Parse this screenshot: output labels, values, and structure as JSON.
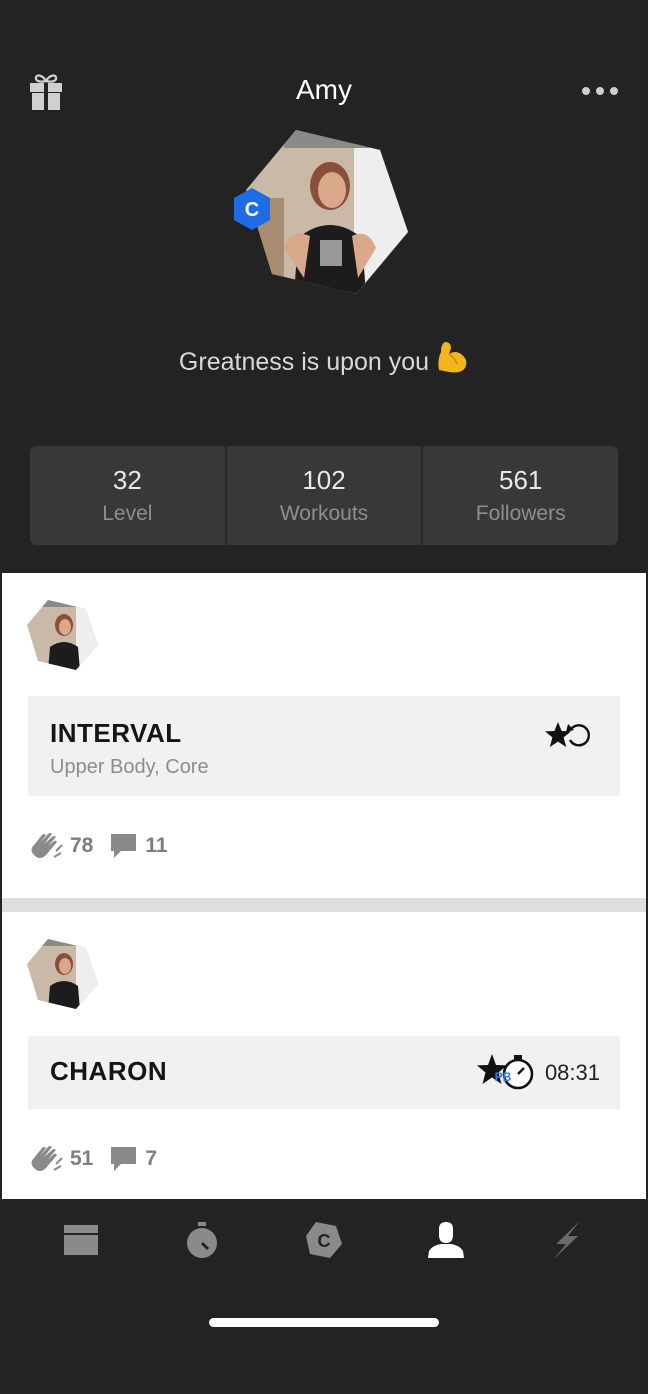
{
  "header": {
    "title": "Amy",
    "tagline": "Greatness is upon you",
    "tagline_emoji": "💪",
    "badge_letter": "C"
  },
  "stats": [
    {
      "value": "32",
      "label": "Level"
    },
    {
      "value": "102",
      "label": "Workouts"
    },
    {
      "value": "561",
      "label": "Followers"
    }
  ],
  "feed": [
    {
      "workout_name": "INTERVAL",
      "workout_sub": "Upper Body, Core",
      "claps": "78",
      "comments": "11",
      "icon": "star-retry-icon"
    },
    {
      "workout_name": "CHARON",
      "workout_time": "08:31",
      "pb_label": "PB",
      "claps": "51",
      "comments": "7",
      "icon": "personal-best-stopwatch-icon"
    }
  ],
  "tabbar": {
    "items": [
      "workouts-icon",
      "timer-icon",
      "crossfit-c-icon",
      "profile-icon",
      "activity-icon"
    ],
    "active_index": 3
  },
  "colors": {
    "background": "#232323",
    "stat_box": "#383838",
    "badge_blue": "#1e6be6",
    "pb_blue": "#2e7be8"
  }
}
